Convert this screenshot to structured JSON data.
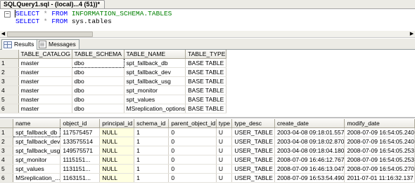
{
  "document_tab": {
    "title": "SQLQuery1.sql - (local)...4 (51))*"
  },
  "editor": {
    "collapse_symbol": "−",
    "line1": {
      "kw1": "SELECT",
      "op": "*",
      "kw2": "FROM",
      "obj": "INFORMATION_SCHEMA.TABLES"
    },
    "line2": {
      "kw1": "SELECT",
      "op": "*",
      "kw2": "FROM",
      "obj": "sys.tables"
    }
  },
  "scroll_arrows": {
    "left": "◀",
    "right": "▶"
  },
  "results_tabs": [
    {
      "label": "Results",
      "icon": "grid-icon",
      "active": true
    },
    {
      "label": "Messages",
      "icon": "messages-icon",
      "active": false
    }
  ],
  "grid1": {
    "columns": [
      "TABLE_CATALOG",
      "TABLE_SCHEMA",
      "TABLE_NAME",
      "TABLE_TYPE"
    ],
    "rows": [
      {
        "n": "1",
        "cells": [
          "master",
          "dbo",
          "spt_fallback_db",
          "BASE TABLE"
        ]
      },
      {
        "n": "2",
        "cells": [
          "master",
          "dbo",
          "spt_fallback_dev",
          "BASE TABLE"
        ]
      },
      {
        "n": "3",
        "cells": [
          "master",
          "dbo",
          "spt_fallback_usg",
          "BASE TABLE"
        ]
      },
      {
        "n": "4",
        "cells": [
          "master",
          "dbo",
          "spt_monitor",
          "BASE TABLE"
        ]
      },
      {
        "n": "5",
        "cells": [
          "master",
          "dbo",
          "spt_values",
          "BASE TABLE"
        ]
      },
      {
        "n": "6",
        "cells": [
          "master",
          "dbo",
          "MSreplication_options",
          "BASE TABLE"
        ]
      }
    ]
  },
  "grid2": {
    "columns": [
      "name",
      "object_id",
      "principal_id",
      "schema_id",
      "parent_object_id",
      "type",
      "type_desc",
      "create_date",
      "modify_date"
    ],
    "rows": [
      {
        "n": "1",
        "cells": [
          "spt_fallback_db",
          "117575457",
          "NULL",
          "1",
          "0",
          "U",
          "USER_TABLE",
          "2003-04-08 09:18:01.557",
          "2008-07-09 16:54:05.240"
        ]
      },
      {
        "n": "2",
        "cells": [
          "spt_fallback_dev",
          "133575514",
          "NULL",
          "1",
          "0",
          "U",
          "USER_TABLE",
          "2003-04-08 09:18:02.870",
          "2008-07-09 16:54:05.240"
        ]
      },
      {
        "n": "3",
        "cells": [
          "spt_fallback_usg",
          "149575571",
          "NULL",
          "1",
          "0",
          "U",
          "USER_TABLE",
          "2003-04-08 09:18:04.180",
          "2008-07-09 16:54:05.253"
        ]
      },
      {
        "n": "4",
        "cells": [
          "spt_monitor",
          "1115151...",
          "NULL",
          "1",
          "0",
          "U",
          "USER_TABLE",
          "2008-07-09 16:46:12.767",
          "2008-07-09 16:54:05.253"
        ]
      },
      {
        "n": "5",
        "cells": [
          "spt_values",
          "1131151...",
          "NULL",
          "1",
          "0",
          "U",
          "USER_TABLE",
          "2008-07-09 16:46:13.047",
          "2008-07-09 16:54:05.270"
        ]
      },
      {
        "n": "6",
        "cells": [
          "MSreplication_...",
          "1163151...",
          "NULL",
          "1",
          "0",
          "U",
          "USER_TABLE",
          "2008-07-09 16:53:54.490",
          "2011-07-01 11:16:32.137"
        ]
      }
    ]
  }
}
